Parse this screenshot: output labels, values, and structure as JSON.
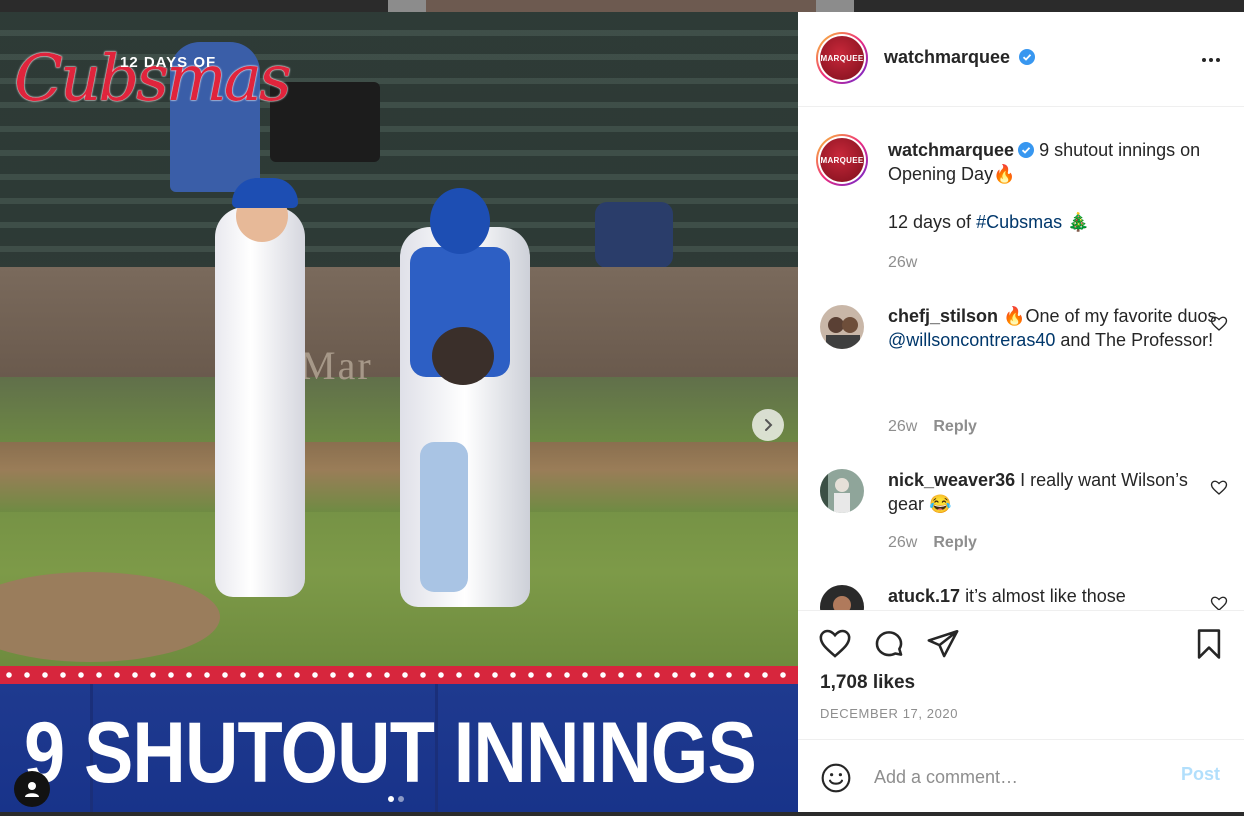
{
  "media": {
    "logo_small": "12 DAYS OF",
    "logo_script": "Cubsmas",
    "wall_text": "Mar",
    "banner_text": "9 SHUTOUT INNINGS",
    "carousel": {
      "count": 2,
      "active_index": 1
    }
  },
  "header": {
    "username": "watchmarquee",
    "avatar_text": "MARQUEE"
  },
  "caption": {
    "username": "watchmarquee",
    "line1": "9 shutout innings on Opening Day🔥",
    "line2_prefix": "12 days of ",
    "hashtag": "#Cubsmas",
    "line2_suffix": " 🎄",
    "time": "26w"
  },
  "comments": [
    {
      "username": "chefj_stilson",
      "text_before": "🔥One of my favorite duos ",
      "mention": "@willsoncontreras40",
      "text_after": " and The Professor!",
      "time": "26w",
      "reply": "Reply"
    },
    {
      "username": "nick_weaver36",
      "text_before": "I really want Wilson’s gear 😂",
      "time": "26w",
      "reply": "Reply"
    },
    {
      "username": "atuck.17",
      "text_before": "it’s almost like those"
    }
  ],
  "likes": "1,708 likes",
  "date": "DECEMBER 17, 2020",
  "add_comment": {
    "placeholder": "Add a comment…",
    "post_label": "Post"
  }
}
